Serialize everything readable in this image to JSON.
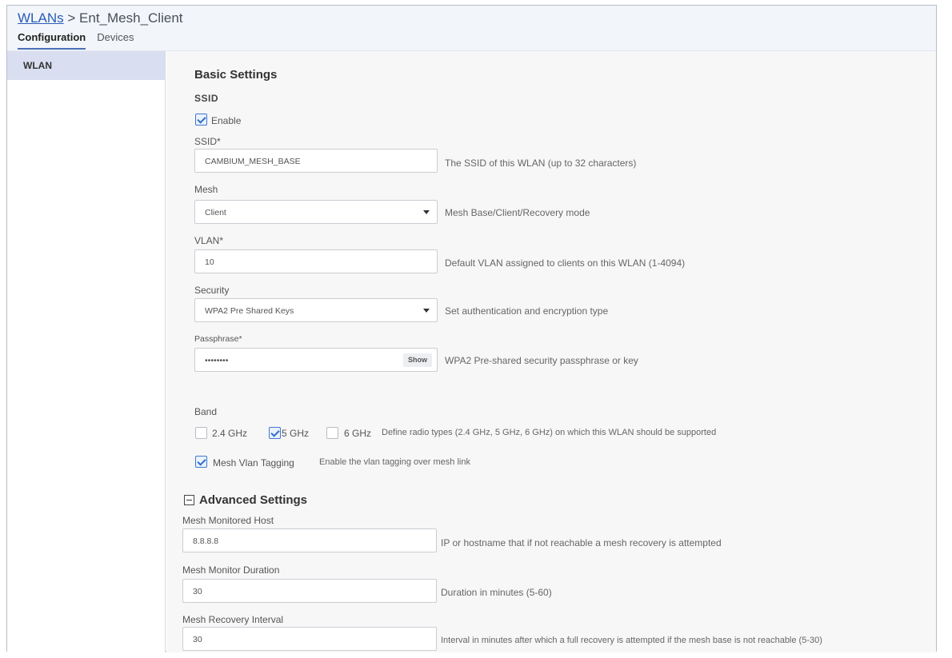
{
  "breadcrumb": {
    "parent": "WLANs",
    "separator": ">",
    "current": "Ent_Mesh_Client"
  },
  "tabs": [
    {
      "label": "Configuration",
      "active": true
    },
    {
      "label": "Devices",
      "active": false
    }
  ],
  "sidebar": {
    "items": [
      {
        "label": "WLAN",
        "active": true
      }
    ]
  },
  "basic": {
    "title": "Basic Settings",
    "ssid_section": "SSID",
    "enable_label": "Enable",
    "enable_checked": true,
    "ssid": {
      "label": "SSID*",
      "value": "CAMBIUM_MESH_BASE",
      "help": "The SSID of this WLAN (up to 32 characters)"
    },
    "mesh": {
      "label": "Mesh",
      "value": "Client",
      "help": "Mesh Base/Client/Recovery mode"
    },
    "vlan": {
      "label": "VLAN*",
      "value": "10",
      "help": "Default VLAN assigned to clients on this WLAN (1-4094)"
    },
    "security": {
      "label": "Security",
      "value": "WPA2 Pre Shared Keys",
      "help": "Set authentication and encryption type"
    },
    "passphrase": {
      "label": "Passphrase*",
      "value": "••••••••",
      "show_label": "Show",
      "help": "WPA2 Pre-shared security passphrase or key"
    },
    "band": {
      "label": "Band",
      "options": [
        {
          "label": "2.4 GHz",
          "checked": false
        },
        {
          "label": "5 GHz",
          "checked": true
        },
        {
          "label": "6 GHz",
          "checked": false
        }
      ],
      "help": "Define radio types (2.4 GHz, 5 GHz, 6 GHz) on which this WLAN should be supported"
    },
    "mesh_vlan_tagging": {
      "label": "Mesh Vlan Tagging",
      "checked": true,
      "help": "Enable the vlan tagging over mesh link"
    }
  },
  "advanced": {
    "title": "Advanced Settings",
    "monitored_host": {
      "label": "Mesh Monitored Host",
      "value": "8.8.8.8",
      "help": "IP or hostname that if not reachable a mesh recovery is attempted"
    },
    "monitor_duration": {
      "label": "Mesh Monitor Duration",
      "value": "30",
      "help": "Duration in minutes (5-60)"
    },
    "recovery_interval": {
      "label": "Mesh Recovery Interval",
      "value": "30",
      "help": "Interval in minutes after which a full recovery is attempted if the mesh base is not reachable (5-30)"
    }
  },
  "colors": {
    "accent": "#2f6fcc",
    "sidebar_active": "#d9dff0",
    "content_bg": "#f7f7f7"
  }
}
